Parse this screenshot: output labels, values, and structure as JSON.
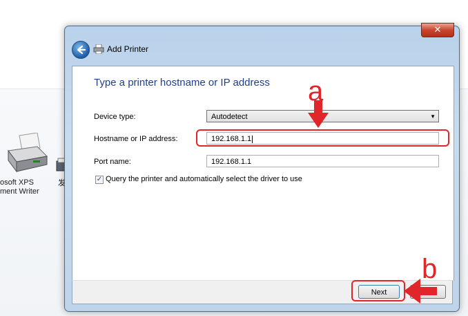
{
  "background": {
    "printer_label_line1": "osoft XPS",
    "printer_label_line2": "ment Writer",
    "fax_label": "发"
  },
  "window": {
    "title": "Add Printer",
    "close_glyph": "✕",
    "heading": "Type a printer hostname or IP address"
  },
  "form": {
    "device_type_label": "Device type:",
    "device_type_value": "Autodetect",
    "hostname_label": "Hostname or IP address:",
    "hostname_value": "192.168.1.1",
    "port_label": "Port name:",
    "port_value": "192.168.1.1",
    "query_checkbox_label": "Query the printer and automatically select the driver to use",
    "query_checked": true
  },
  "footer": {
    "next_label": "Next",
    "cancel_label": ""
  },
  "annotations": {
    "a": "a",
    "b": "b",
    "color": "#e0262a"
  },
  "icons": {
    "back": "back-arrow-icon",
    "printer": "printer-icon",
    "dropdown": "chevron-down-icon"
  }
}
